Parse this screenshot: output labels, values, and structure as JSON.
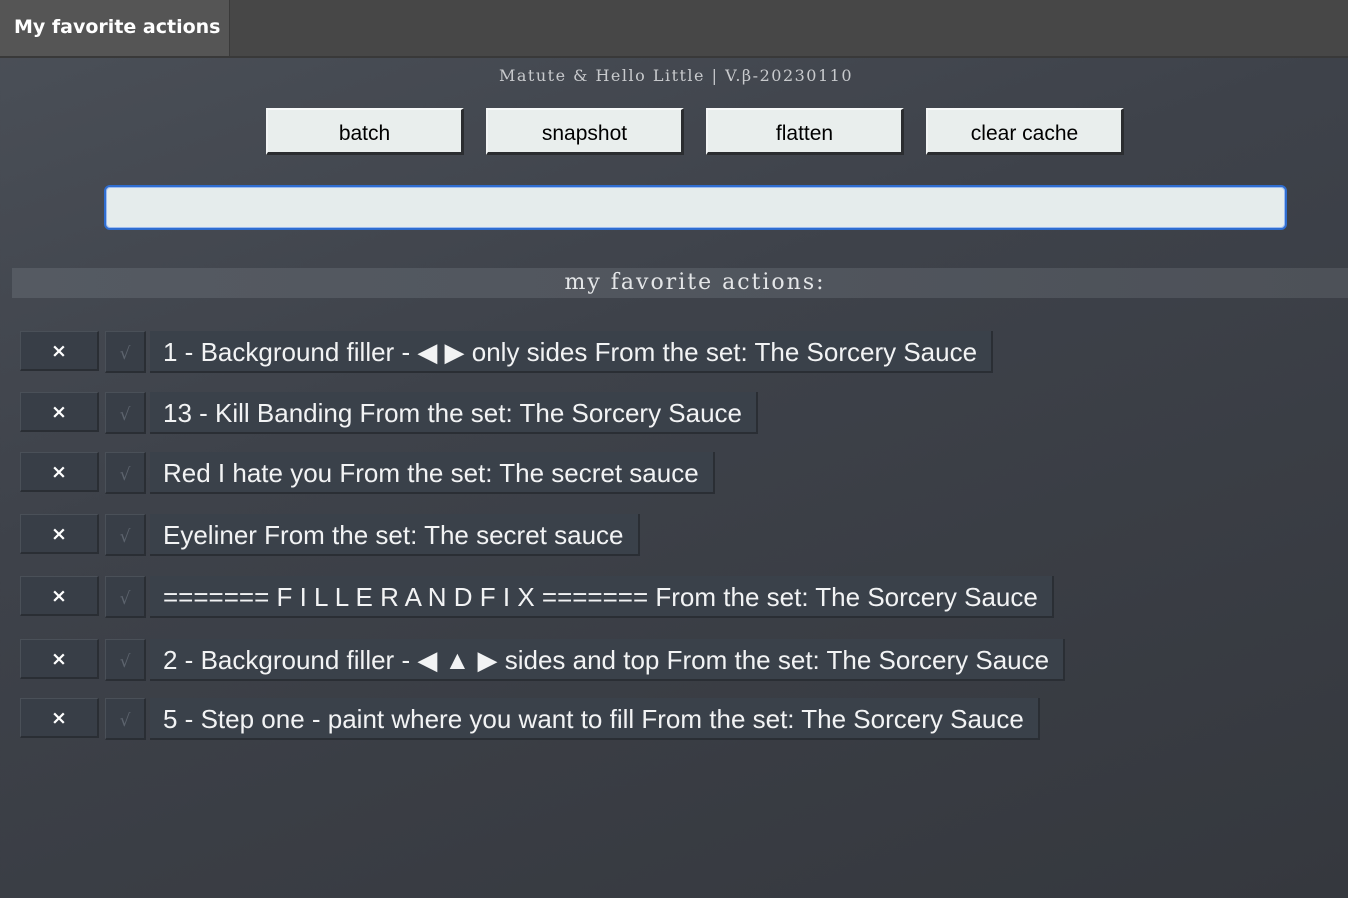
{
  "window": {
    "tab_label": "My favorite actions"
  },
  "header": {
    "version_text": "Matute & Hello Little | V.β-20230110"
  },
  "toolbar": {
    "batch_label": "batch",
    "snapshot_label": "snapshot",
    "flatten_label": "flatten",
    "clear_cache_label": "clear cache"
  },
  "search": {
    "value": "",
    "placeholder": ""
  },
  "section": {
    "title": "my favorite actions:"
  },
  "actions": {
    "remove_glyph": "×",
    "check_glyph": "√",
    "items": [
      {
        "label": "1 - Background filler - ◀ ▶ only sides From the set: The Sorcery Sauce"
      },
      {
        "label": "13 - Kill Banding From the set: The Sorcery Sauce"
      },
      {
        "label": "Red I hate you From the set: The secret sauce"
      },
      {
        "label": "Eyeliner From the set: The secret sauce"
      },
      {
        "label": "======= F I L L E R A N D F I X ======= From the set: The Sorcery Sauce"
      },
      {
        "label": "2 - Background filler - ◀ ▲ ▶ sides and top From the set: The Sorcery Sauce"
      },
      {
        "label": "5 - Step one - paint where you want to fill From the set: The Sorcery Sauce"
      }
    ]
  },
  "colors": {
    "accent_focus": "#2f6dd0",
    "button_face": "#e9eeed",
    "row_face": "#3a414a"
  }
}
